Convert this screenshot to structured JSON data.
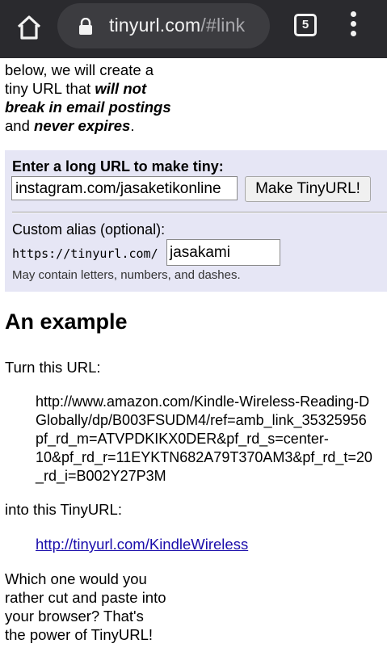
{
  "browser": {
    "url_host": "tinyurl.com",
    "url_path": "/#link",
    "tab_count": "5"
  },
  "intro": {
    "line_start": "below, we will create a tiny URL that ",
    "bold1": "will not break in email postings",
    "mid": " and ",
    "bold2": "never expires",
    "end": "."
  },
  "form": {
    "label": "Enter a long URL to make tiny:",
    "long_url_value": "instagram.com/jasaketikonline",
    "make_button": "Make TinyURL!",
    "alias_label": "Custom alias (optional):",
    "alias_prefix": "https://tinyurl.com/",
    "alias_value": "jasakami",
    "hint": "May contain letters, numbers, and dashes."
  },
  "example": {
    "heading": "An example",
    "turn_text": "Turn this URL:",
    "long_url_lines": [
      "http://www.amazon.com/Kindle-Wireless-Reading-D",
      "Globally/dp/B003FSUDM4/ref=amb_link_35325956",
      "pf_rd_m=ATVPDKIKX0DER&pf_rd_s=center-",
      "10&pf_rd_r=11EYKTN682A79T370AM3&pf_rd_t=20",
      "_rd_i=B002Y27P3M"
    ],
    "into_text": "into this TinyURL:",
    "tiny_link": "http://tinyurl.com/KindleWireless",
    "closing": "Which one would you rather cut and paste into your browser? That's the power of TinyURL!"
  }
}
